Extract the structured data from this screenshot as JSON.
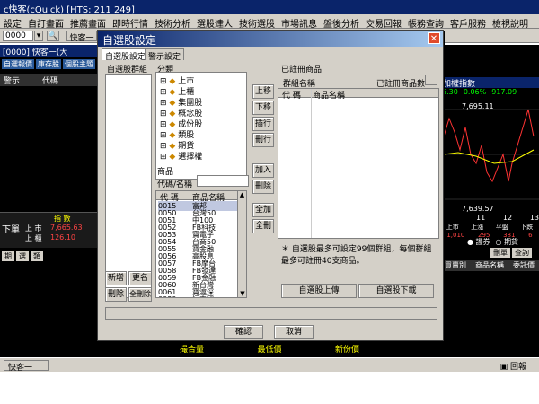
{
  "app": {
    "title": "c快客(cQuick)  [HTS: 211 249]"
  },
  "menu": [
    "設定",
    "自訂畫面",
    "推薦畫面",
    "即時行情",
    "技術分析",
    "選股達人",
    "技術選股",
    "市場訊息",
    "盤後分析",
    "交易回報",
    "帳務查詢",
    "客戶服務",
    "檢視說明"
  ],
  "toolbar": {
    "stock_code": "0000",
    "tab_label": "快客一"
  },
  "status": {
    "left_label": "快客一",
    "right_label": "回報"
  },
  "dialog": {
    "title": "自選股設定",
    "tabs": [
      "自選股設定",
      "警示設定"
    ],
    "group_list_label": "自選股群組",
    "category_label": "分類",
    "categories": [
      "上市",
      "上櫃",
      "集團股",
      "概念股",
      "成份股",
      "類股",
      "期貨",
      "選擇權"
    ],
    "product_label": "商品",
    "search_label": "代碼/名稱",
    "search_value": "",
    "product_header": {
      "code": "代 碼",
      "name": "商品名稱"
    },
    "products": [
      {
        "code": "0015",
        "name": "富邦"
      },
      {
        "code": "0050",
        "name": "台灣50"
      },
      {
        "code": "0051",
        "name": "中100"
      },
      {
        "code": "0052",
        "name": "FB科技"
      },
      {
        "code": "0053",
        "name": "寶電子"
      },
      {
        "code": "0054",
        "name": "台商50"
      },
      {
        "code": "0055",
        "name": "寶金融"
      },
      {
        "code": "0056",
        "name": "高股息"
      },
      {
        "code": "0057",
        "name": "FB摩台"
      },
      {
        "code": "0058",
        "name": "FB發達"
      },
      {
        "code": "0059",
        "name": "FB金融"
      },
      {
        "code": "0060",
        "name": "新台灣"
      },
      {
        "code": "0061",
        "name": "寶滬深"
      },
      {
        "code": "0080",
        "name": "恒中國"
      },
      {
        "code": "0081",
        "name": "恒香港"
      }
    ],
    "registered_label": "已註冊商品",
    "group_name_label": "群組名稱",
    "registered_count_label": "已註冊商品數",
    "reg_header": {
      "code": "代 碼",
      "name": "商品名稱"
    },
    "buttons": {
      "up": "上移",
      "down": "下移",
      "insert": "插行",
      "delete_row": "刪行",
      "add": "加入",
      "remove": "刪除",
      "add_all": "全加",
      "remove_all": "全刪",
      "new": "新增",
      "rename": "更名",
      "delete": "刪除",
      "delete_all": "全刪除",
      "upload": "自選股上傳",
      "download": "自選股下載",
      "confirm": "確認",
      "cancel": "取消"
    },
    "note": "＊ 自選股最多可設定99個群組，每個群組最多可註冊40支商品。"
  },
  "background": {
    "left_tabs": [
      "自選報價",
      "庫存股",
      "個股主題"
    ],
    "left_headers": [
      "警示",
      "代碼"
    ],
    "left_bottom": {
      "label": "下單",
      "col": "指 數",
      "rows": [
        {
          "name": "上 市",
          "value": "7,665.63"
        },
        {
          "name": "上 櫃",
          "value": "126.10"
        }
      ]
    },
    "left_small_tabs": [
      "期",
      "選",
      "類"
    ],
    "right_title": "加權指數",
    "right_values": [
      "5.30",
      "0.06%",
      "917.09"
    ],
    "right_price_high": "7,695.11",
    "right_price_low": "7,639.57",
    "right_time_ticks": [
      "11",
      "12",
      "13"
    ],
    "right_table_headers": [
      "上市",
      "上漲",
      "平盤",
      "下跌"
    ],
    "right_table_values": [
      "1,010",
      "295",
      "381",
      "6"
    ],
    "right_radio": [
      "證券",
      "期貨"
    ],
    "right_buttons": [
      "刪單",
      "查詢"
    ],
    "right_headers": [
      "買賣別",
      "商品名稱",
      "委託價"
    ],
    "bottom_labels": [
      "撮合量",
      "最低價",
      "新份價"
    ]
  }
}
